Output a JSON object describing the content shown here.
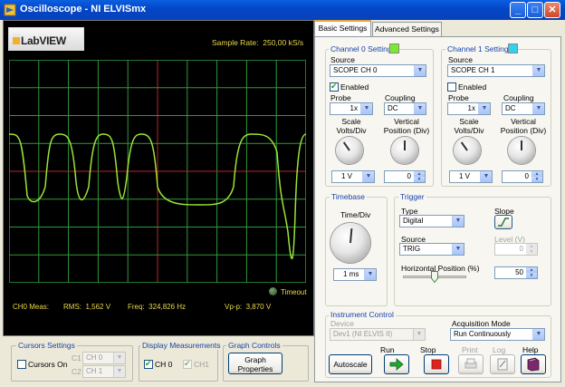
{
  "window": {
    "title": "Oscilloscope - NI ELVISmx",
    "buttons": [
      "minimize",
      "maximize",
      "close"
    ]
  },
  "display": {
    "logo": "LabVIEW",
    "sample_rate_label": "Sample Rate:",
    "sample_rate_value": "250,00 kS/s",
    "timeout_label": "Timeout",
    "trace_color": "#9be336",
    "grid_color": "#2f9a3a",
    "axis_color": "#b8262a",
    "measurements": {
      "channel": "CH0 Meas:",
      "rms_label": "RMS:",
      "rms_value": "1,562 V",
      "freq_label": "Freq:",
      "freq_value": "324,826 Hz",
      "vpp_label": "Vp-p:",
      "vpp_value": "3,870 V"
    }
  },
  "cursors": {
    "title": "Cursors Settings",
    "on_label": "Cursors On",
    "c1_label": "C1",
    "c1_value": "CH 0",
    "c2_label": "C2",
    "c2_value": "CH 1"
  },
  "display_measurements": {
    "title": "Display Measurements",
    "ch0_label": "CH 0",
    "ch1_label": "CH1"
  },
  "graph_controls": {
    "title": "Graph Controls",
    "button_line1": "Graph",
    "button_line2": "Properties"
  },
  "tabs": {
    "basic": "Basic Settings",
    "advanced": "Advanced Settings"
  },
  "channel0": {
    "title": "Channel 0 Settings",
    "color": "#7bea2d",
    "source_label": "Source",
    "source_value": "SCOPE CH 0",
    "enabled_label": "Enabled",
    "probe_label": "Probe",
    "probe_value": "1x",
    "coupling_label": "Coupling",
    "coupling_value": "DC",
    "scale_label_1": "Scale",
    "scale_label_2": "Volts/Div",
    "vpos_label_1": "Vertical",
    "vpos_label_2": "Position (Div)",
    "scale_value": "1 V",
    "vpos_value": "0"
  },
  "channel1": {
    "title": "Channel 1 Settings",
    "color": "#2ed3f1",
    "source_label": "Source",
    "source_value": "SCOPE CH 1",
    "enabled_label": "Enabled",
    "probe_label": "Probe",
    "probe_value": "1x",
    "coupling_label": "Coupling",
    "coupling_value": "DC",
    "scale_label_1": "Scale",
    "scale_label_2": "Volts/Div",
    "vpos_label_1": "Vertical",
    "vpos_label_2": "Position (Div)",
    "scale_value": "1 V",
    "vpos_value": "0"
  },
  "timebase": {
    "title": "Timebase",
    "label": "Time/Div",
    "value": "1 ms"
  },
  "trigger": {
    "title": "Trigger",
    "type_label": "Type",
    "type_value": "Digital",
    "slope_label": "Slope",
    "source_label": "Source",
    "source_value": "TRIG",
    "level_label": "Level (V)",
    "level_value": "0",
    "hpos_label": "Horizontal Position (%)",
    "hpos_value": "50"
  },
  "instrument": {
    "title": "Instrument Control",
    "device_label": "Device",
    "device_value": "Dev1 (NI ELVIS II)",
    "acq_label": "Acquisition Mode",
    "acq_value": "Run Continuously",
    "autoscale": "Autoscale",
    "run": "Run",
    "stop": "Stop",
    "print": "Print",
    "log": "Log",
    "help": "Help"
  }
}
